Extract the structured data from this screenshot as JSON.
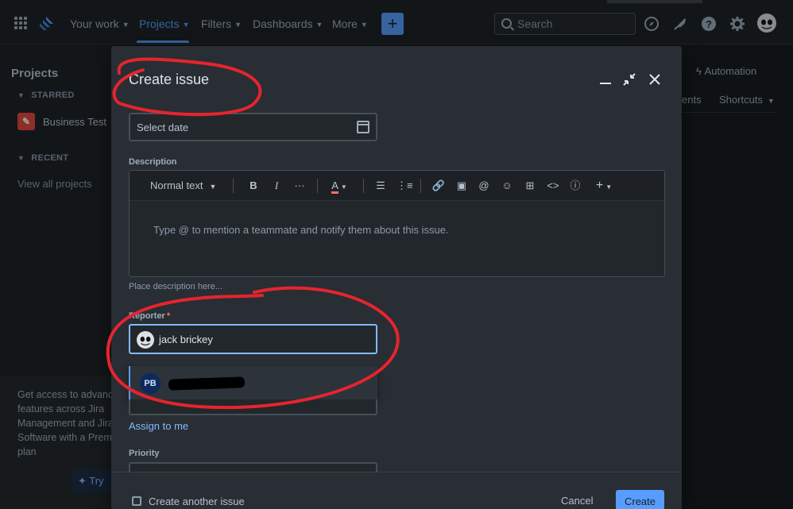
{
  "topnav": {
    "items": [
      {
        "label": "Your work"
      },
      {
        "label": "Projects"
      },
      {
        "label": "Filters"
      },
      {
        "label": "Dashboards"
      },
      {
        "label": "More"
      }
    ],
    "search_placeholder": "Search"
  },
  "sidebar": {
    "title": "Projects",
    "starred_label": "STARRED",
    "starred_project": "Business Test",
    "recent_label": "RECENT",
    "view_all": "View all projects",
    "promo_text": "Get access to advanced features across Jira Management and Jira Software with a Premium plan",
    "try_label": "Try"
  },
  "background": {
    "automation": "Automation",
    "tab_partial": "ents",
    "shortcuts": "Shortcuts"
  },
  "modal": {
    "title": "Create issue",
    "date_placeholder": "Select date",
    "description_label": "Description",
    "text_style": "Normal text",
    "editor_placeholder": "Type @ to mention a teammate and notify them about this issue.",
    "help_text": "Place description here...",
    "reporter_label": "Reporter",
    "required_mark": "*",
    "reporter_value": "jack brickey",
    "dropdown_initials": "PB",
    "assign_to_me": "Assign to me",
    "priority_label": "Priority",
    "create_another": "Create another issue",
    "cancel": "Cancel",
    "create": "Create"
  },
  "colors": {
    "accent": "#579dff",
    "annotation": "#e5242f"
  }
}
